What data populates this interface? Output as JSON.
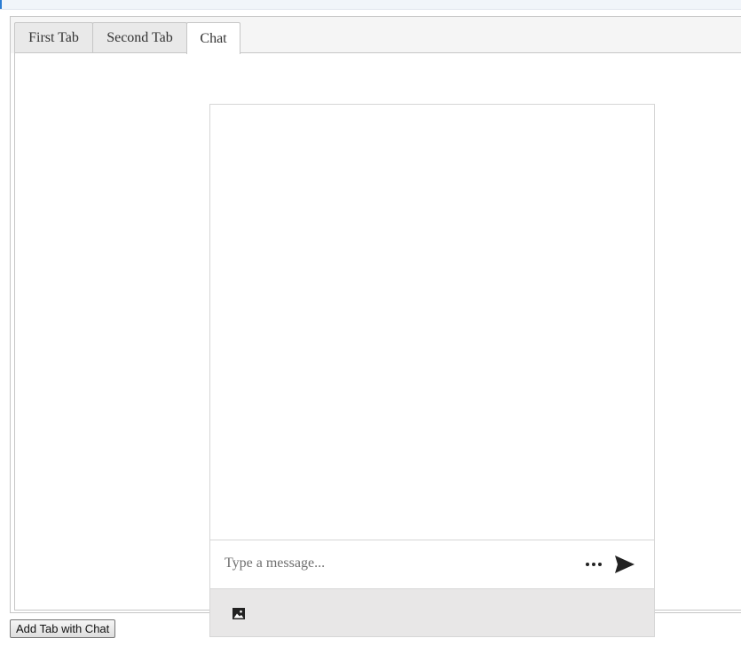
{
  "tabs": [
    {
      "label": "First Tab",
      "active": false
    },
    {
      "label": "Second Tab",
      "active": false
    },
    {
      "label": "Chat",
      "active": true
    }
  ],
  "chat": {
    "messages": [],
    "input": {
      "value": "",
      "placeholder": "Type a message..."
    },
    "icons": {
      "more": "more-horizontal-icon",
      "send": "send-icon",
      "image": "image-icon"
    }
  },
  "footer": {
    "add_tab_label": "Add Tab with Chat"
  },
  "colors": {
    "accent": "#2b7cd3",
    "toolbar_bg": "#e8e7e7",
    "border": "#c6c6c6"
  }
}
